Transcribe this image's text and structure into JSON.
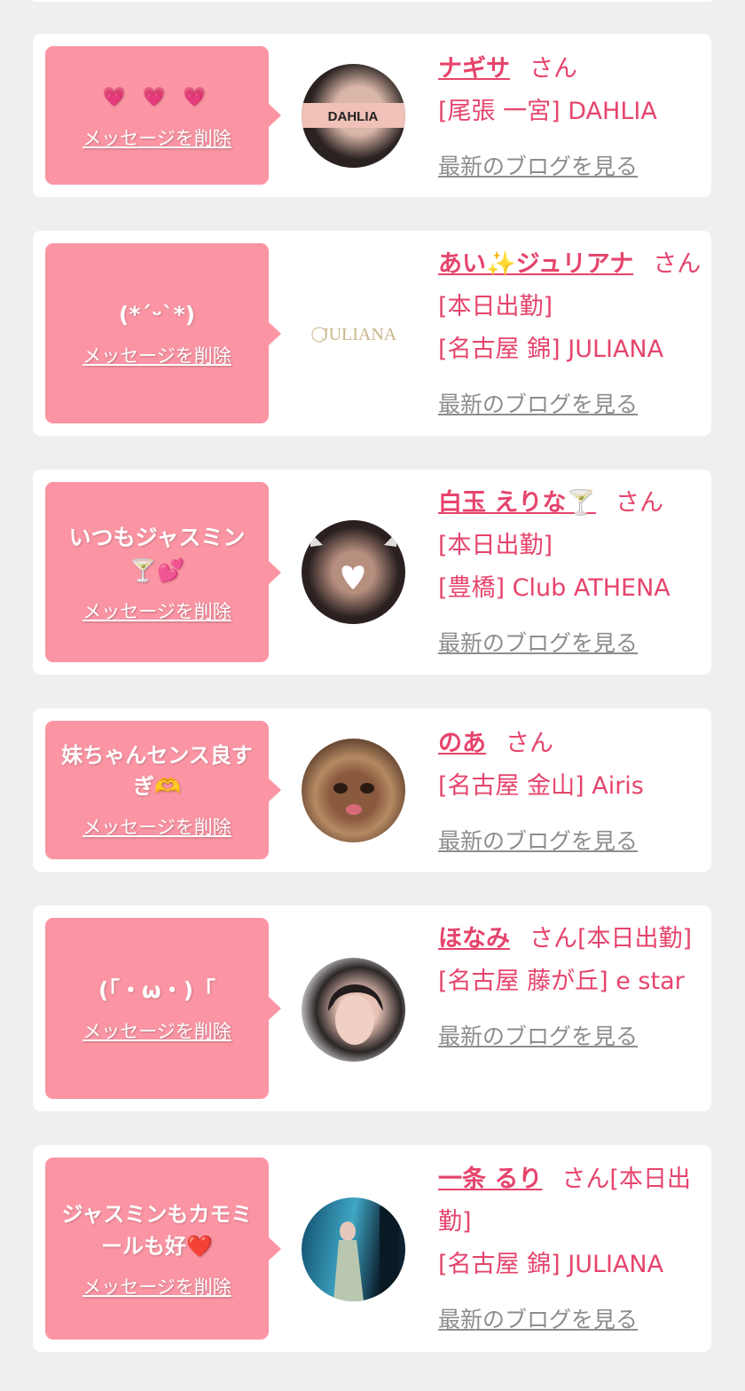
{
  "delete_label": "メッセージを削除",
  "blog_label": "最新のブログを見る",
  "san": "さん",
  "cards": [
    {
      "message": "💗 💗 💗",
      "name": "ナギサ",
      "shift": "",
      "shop": "[尾張 一宮] DAHLIA",
      "avatar_text": "DAHLIA"
    },
    {
      "message": "(*´ᵕ`*)",
      "name": "あい✨ジュリアナ",
      "shift": "[本日出勤]",
      "shop": "[名古屋 錦] JULIANA",
      "avatar_text": "JULIANA"
    },
    {
      "message": "いつもジャスミン🍸💕",
      "name": "白玉 えりな🍸",
      "shift": "[本日出勤]",
      "shop": "[豊橋] Club ATHENA",
      "avatar_text": ""
    },
    {
      "message": "妹ちゃんセンス良すぎ🫶",
      "name": "のあ",
      "shift": "",
      "shop": "[名古屋 金山] Airis",
      "avatar_text": ""
    },
    {
      "message": "(「・ω・)「",
      "name": "ほなみ",
      "shift": "[本日出勤]",
      "shop": "[名古屋 藤が丘] e star",
      "avatar_text": ""
    },
    {
      "message": "ジャスミンもカモミールも好❤️",
      "name": "一条 るり",
      "shift": "[本日出勤]",
      "shop": "[名古屋 錦] JULIANA",
      "avatar_text": ""
    }
  ],
  "colors": {
    "bubble": "#fb95a4",
    "accent": "#e6446c",
    "link_gray": "#8d8d8d",
    "background": "#efefef"
  }
}
